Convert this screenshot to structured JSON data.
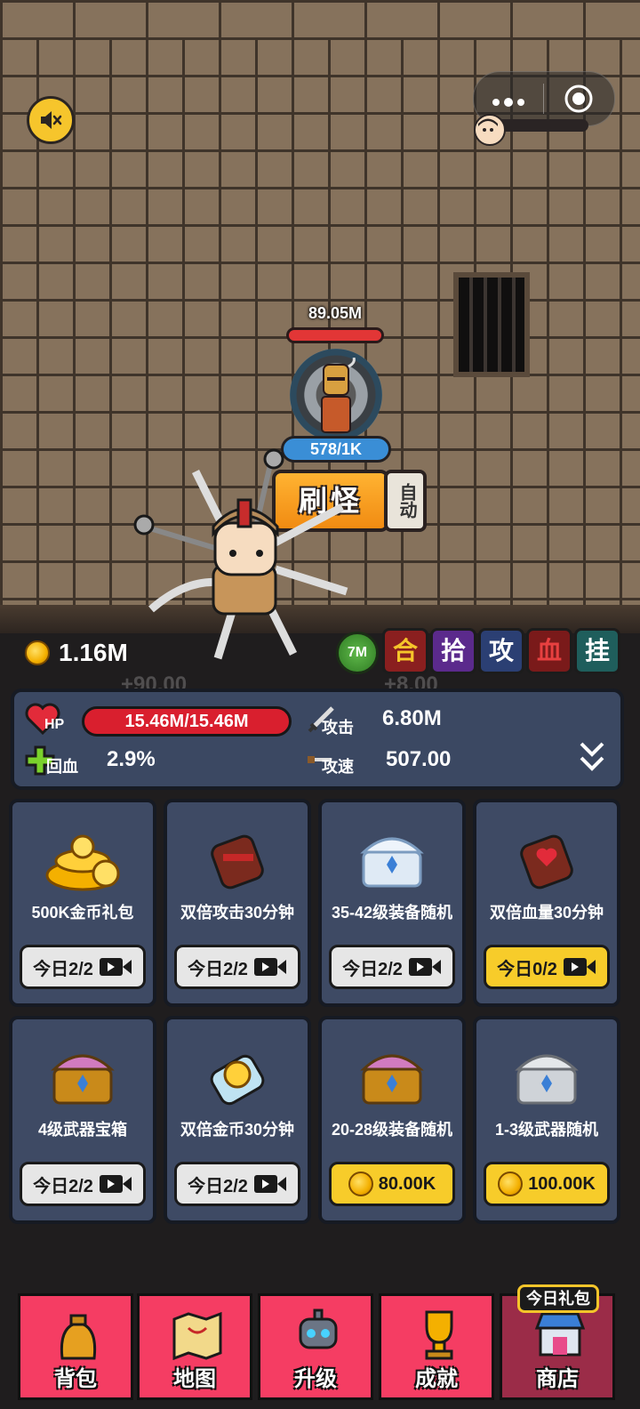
{
  "scene": {
    "enemy_hp_value": "89.05M",
    "enemy_count": "578/1K",
    "spawn_label": "刷怪",
    "auto_label": "自动"
  },
  "resources": {
    "gold": "1.16M",
    "wave_badge": "7M",
    "float_left": "+90.00",
    "float_right": "+8.00"
  },
  "buff_tiles": [
    {
      "label": "合",
      "bg": "#8a1f1f",
      "fg": "#f5c52a"
    },
    {
      "label": "拾",
      "bg": "#5b2a8c",
      "fg": "#ffffff"
    },
    {
      "label": "攻",
      "bg": "#2b3f73",
      "fg": "#ffffff"
    },
    {
      "label": "血",
      "bg": "#7a1a1a",
      "fg": "#e84040"
    },
    {
      "label": "挂",
      "bg": "#1f5e5c",
      "fg": "#ffffff"
    }
  ],
  "stats": {
    "hp_label": "HP",
    "hp_value": "15.46M/15.46M",
    "regen_label": "回血",
    "regen_value": "2.9%",
    "attack_label": "攻击",
    "attack_value": "6.80M",
    "speed_label": "攻速",
    "speed_value": "507.00"
  },
  "shop": [
    {
      "title": "500K金币礼包",
      "icon": "gold-pile-icon",
      "button": "今日2/2",
      "style": "gray",
      "kind": "video"
    },
    {
      "title": "双倍攻击30分钟",
      "icon": "scroll-icon",
      "button": "今日2/2",
      "style": "gray",
      "kind": "video"
    },
    {
      "title": "35-42级装备随机",
      "icon": "crystal-chest-icon",
      "button": "今日2/2",
      "style": "gray",
      "kind": "video"
    },
    {
      "title": "双倍血量30分钟",
      "icon": "heart-scroll-icon",
      "button": "今日0/2",
      "style": "yellow",
      "kind": "video"
    },
    {
      "title": "4级武器宝箱",
      "icon": "gold-chest-icon",
      "button": "今日2/2",
      "style": "gray",
      "kind": "video"
    },
    {
      "title": "双倍金币30分钟",
      "icon": "coin-scroll-icon",
      "button": "今日2/2",
      "style": "gray",
      "kind": "video"
    },
    {
      "title": "20-28级装备随机",
      "icon": "gold-chest-icon",
      "button": "80.00K",
      "style": "yellow",
      "kind": "gold"
    },
    {
      "title": "1-3级武器随机",
      "icon": "silver-chest-icon",
      "button": "100.00K",
      "style": "yellow",
      "kind": "gold"
    }
  ],
  "nav": {
    "items": [
      {
        "label": "背包",
        "icon": "bag-icon"
      },
      {
        "label": "地图",
        "icon": "map-icon"
      },
      {
        "label": "升级",
        "icon": "robot-icon"
      },
      {
        "label": "成就",
        "icon": "trophy-icon"
      },
      {
        "label": "商店",
        "icon": "shop-icon"
      }
    ],
    "gift_badge": "今日礼包",
    "active": "商店"
  }
}
